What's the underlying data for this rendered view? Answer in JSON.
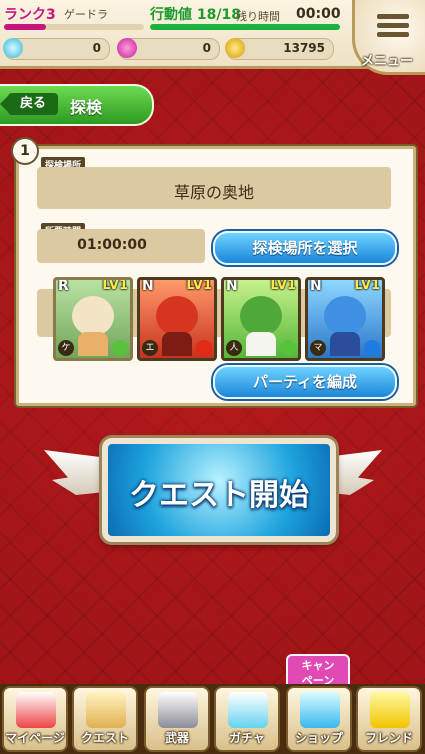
{
  "status": {
    "rank_label": "ランク",
    "rank_value": "3",
    "player_name": "ゲードラ",
    "action_label": "行動値",
    "action_value": "18/18",
    "remaining_label": "残り時間",
    "remaining_value": "00:00",
    "currencies": [
      {
        "icon": "diamond-icon",
        "value": "0"
      },
      {
        "icon": "gem-icon",
        "value": "0"
      },
      {
        "icon": "coin-icon",
        "value": "13795"
      }
    ],
    "menu_label": "メニュー"
  },
  "header": {
    "back_label": "戻る",
    "title": "探検"
  },
  "panel": {
    "number": "1",
    "location_label": "探検場所",
    "location_value": "草原の奥地",
    "time_label": "所要時間",
    "time_value": "01:00:00",
    "select_location_label": "探検場所を選択",
    "edit_party_label": "パーティを編成",
    "party": [
      {
        "rarity": "R",
        "level": "LV1",
        "tag": "ケ"
      },
      {
        "rarity": "N",
        "level": "LV1",
        "tag": "エ"
      },
      {
        "rarity": "N",
        "level": "LV1",
        "tag": "人"
      },
      {
        "rarity": "N",
        "level": "LV1",
        "tag": "マ"
      }
    ]
  },
  "quest_start_label": "クエスト開始",
  "nav": {
    "campaign_line1": "キャン",
    "campaign_line2": "ペーン",
    "items": [
      {
        "label": "マイページ",
        "icon": "flag-icon"
      },
      {
        "label": "クエスト",
        "icon": "scroll-icon"
      },
      {
        "label": "武器",
        "icon": "swords-icon"
      },
      {
        "label": "ガチャ",
        "icon": "crystal-icon"
      },
      {
        "label": "ショップ",
        "icon": "gem-icon"
      },
      {
        "label": "フレンド",
        "icon": "friend-icon"
      }
    ]
  }
}
